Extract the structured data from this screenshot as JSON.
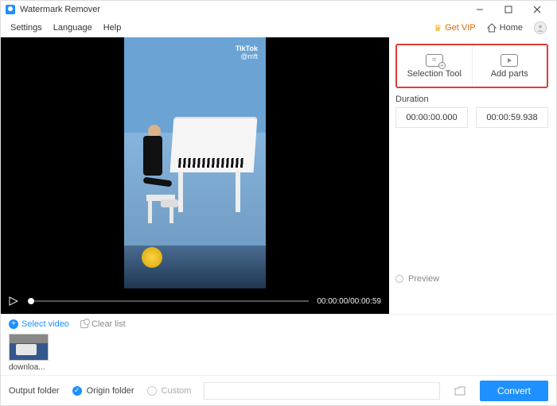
{
  "titlebar": {
    "title": "Watermark Remover"
  },
  "menubar": {
    "settings": "Settings",
    "language": "Language",
    "help": "Help",
    "get_vip": "Get VIP",
    "home": "Home"
  },
  "video": {
    "brand": "TikTok",
    "handle": "@mft",
    "current_time": "00:00:00",
    "total_time": "00:00:59"
  },
  "right_panel": {
    "selection_tool": "Selection Tool",
    "add_parts": "Add parts",
    "duration_label": "Duration",
    "start_time": "00:00:00.000",
    "end_time": "00:00:59.938",
    "preview_label": "Preview"
  },
  "file_strip": {
    "select_video": "Select video",
    "clear_list": "Clear list",
    "items": [
      {
        "label": "downloa..."
      }
    ]
  },
  "footer": {
    "output_folder_label": "Output folder",
    "origin_folder_label": "Origin folder",
    "custom_label": "Custom",
    "convert_label": "Convert"
  }
}
